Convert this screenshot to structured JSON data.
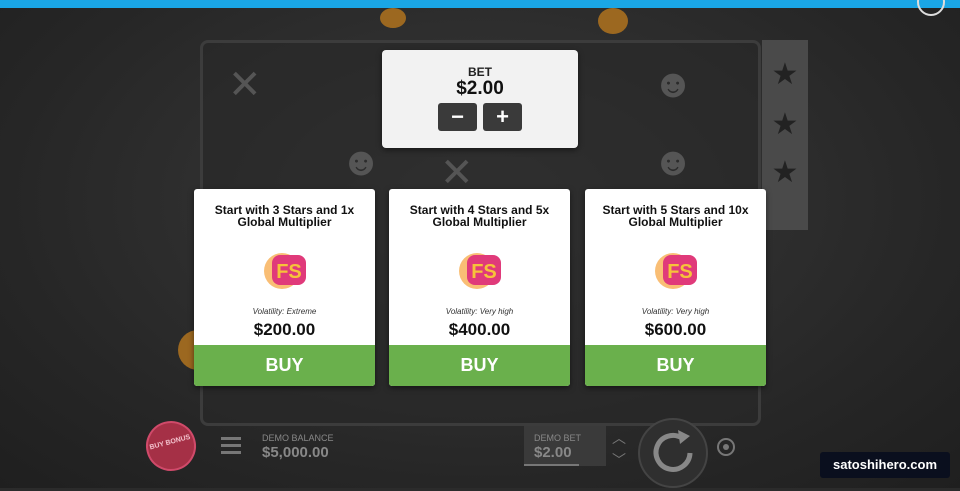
{
  "bet_panel": {
    "label": "BET",
    "value": "$2.00",
    "minus": "−",
    "plus": "+"
  },
  "cards": [
    {
      "title_line1": "Start with 3 Stars and 1x",
      "title_line2": "Global Multiplier",
      "badge": "FS",
      "volatility": "Volatility: Extreme",
      "price": "$200.00",
      "buy": "BUY"
    },
    {
      "title_line1": "Start with 4 Stars and 5x",
      "title_line2": "Global Multiplier",
      "badge": "FS",
      "volatility": "Volatility: Very high",
      "price": "$400.00",
      "buy": "BUY"
    },
    {
      "title_line1": "Start with 5 Stars and 10x",
      "title_line2": "Global Multiplier",
      "badge": "FS",
      "volatility": "Volatility: Very high",
      "price": "$600.00",
      "buy": "BUY"
    }
  ],
  "bottom_bar": {
    "buy_bonus": "BUY BONUS",
    "balance_label": "DEMO BALANCE",
    "balance_value": "$5,000.00",
    "demo_bet_label": "DEMO BET",
    "demo_bet_value": "$2.00"
  },
  "watermark": "satoshihero.com",
  "colors": {
    "buy_green": "#6ab04c",
    "top_bar": "#1aa6e6",
    "badge_pink": "#e03a7a",
    "badge_orange": "#f6a23a"
  },
  "icons": [
    "menu-icon",
    "spin-icon",
    "autoplay-icon",
    "chevron-up-icon",
    "chevron-down-icon",
    "star-icon",
    "fs-badge-icon"
  ]
}
